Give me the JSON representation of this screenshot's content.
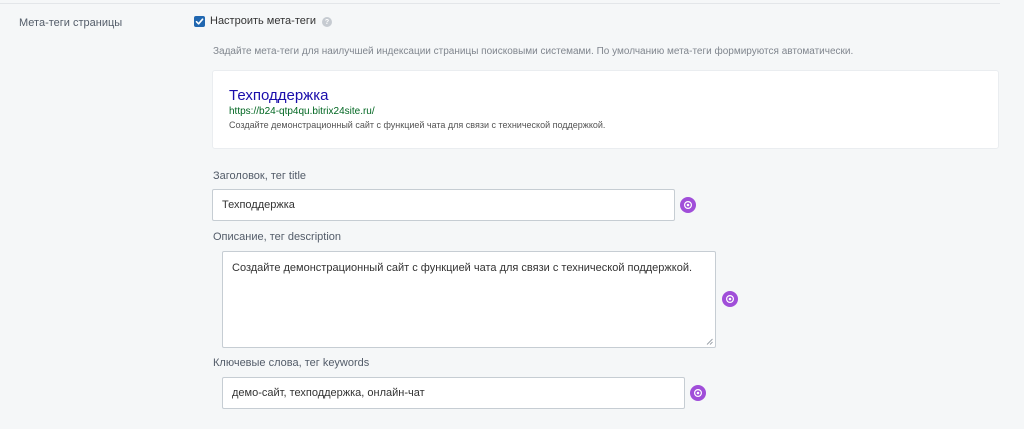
{
  "section": {
    "label": "Мета-теги страницы"
  },
  "customize": {
    "checked": true,
    "label": "Настроить мета-теги"
  },
  "hint": "Задайте мета-теги для наилучшей индексации страницы поисковыми системами. По умолчанию мета-теги формируются автоматически.",
  "preview": {
    "title": "Техподдержка",
    "url": "https://b24-qtp4qu.bitrix24site.ru/",
    "description": "Создайте демонстрационный сайт с функцией чата для связи с технической поддержкой."
  },
  "fields": {
    "title": {
      "label": "Заголовок, тег title",
      "value": "Техподдержка"
    },
    "description": {
      "label": "Описание, тег description",
      "value": "Создайте демонстрационный сайт с функцией чата для связи с технической поддержкой."
    },
    "keywords": {
      "label": "Ключевые слова, тег keywords",
      "value": "демо-сайт, техподдержка, онлайн-чат"
    }
  },
  "icons": {
    "ai_button": "copilot-icon",
    "help": "question-icon",
    "checkbox": "checkmark-icon"
  },
  "colors": {
    "checkbox": "#2067b0",
    "ai_button": "#a04ed9",
    "preview_title": "#1a0dab",
    "preview_url": "#006621"
  }
}
